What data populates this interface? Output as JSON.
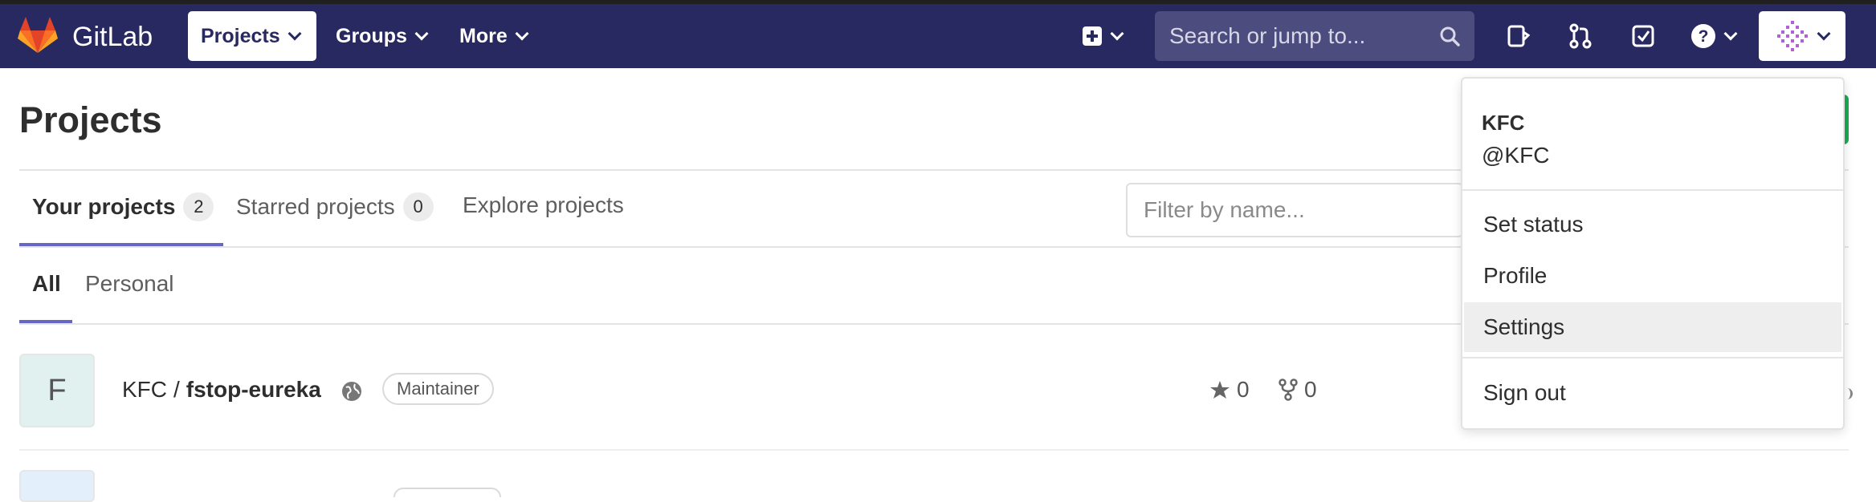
{
  "navbar": {
    "brand": "GitLab",
    "items": [
      {
        "label": "Projects",
        "active": true
      },
      {
        "label": "Groups",
        "active": false
      },
      {
        "label": "More",
        "active": false
      }
    ],
    "search_placeholder": "Search or jump to...",
    "icons": [
      "plus-square-icon",
      "todo-clipboard-icon",
      "merge-request-icon",
      "check-square-icon",
      "help-icon",
      "user-avatar"
    ]
  },
  "page": {
    "title": "Projects"
  },
  "tabs": [
    {
      "label": "Your projects",
      "count": "2",
      "active": true
    },
    {
      "label": "Starred projects",
      "count": "0",
      "active": false
    },
    {
      "label": "Explore projects",
      "active": false
    }
  ],
  "subtabs": [
    {
      "label": "All",
      "active": true
    },
    {
      "label": "Personal",
      "active": false
    }
  ],
  "filter": {
    "placeholder": "Filter by name..."
  },
  "projects": [
    {
      "avatar_letter": "F",
      "namespace": "KFC",
      "separator": "/",
      "name": "fstop-eureka",
      "visibility": "public",
      "role": "Maintainer",
      "stars": "0",
      "forks": "0"
    }
  ],
  "user_menu": {
    "name": "KFC",
    "username": "@KFC",
    "items": [
      "Set status",
      "Profile",
      "Settings",
      "Sign out"
    ],
    "highlighted": "Settings"
  },
  "colors": {
    "navbar": "#292961",
    "accent_underline": "#6666c4",
    "new_project_green": "#1aaa55"
  }
}
